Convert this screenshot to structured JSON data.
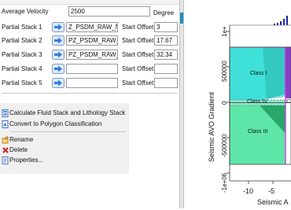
{
  "dialog": {
    "avg_velocity_label": "Average Velocity",
    "avg_velocity_value": "2500",
    "degree_header": "Degree",
    "stacks": [
      {
        "label": "Partial Stack 1",
        "dataset": "Z_PSDM_RAW_NEAR_D",
        "offset_label": "Start Offset",
        "offset_value": "3"
      },
      {
        "label": "Partial Stack 2",
        "dataset": "PZ_PSDM_RAW_MID_D",
        "offset_label": "Start Offset",
        "offset_value": "17.67"
      },
      {
        "label": "Partial Stack 3",
        "dataset": "PZ_PSDM_RAW_FAR_D",
        "offset_label": "Start Offset",
        "offset_value": "32.34"
      },
      {
        "label": "Partial Stack 4",
        "dataset": "",
        "offset_label": "Start Offset",
        "offset_value": ""
      },
      {
        "label": "Partial Stack 5",
        "dataset": "",
        "offset_label": "Start Offset",
        "offset_value": ""
      }
    ]
  },
  "context_menu": {
    "items": [
      {
        "label": "Calculate Fluid Stack and Lithology Stack",
        "icon": "calculate-icon"
      },
      {
        "label": "Convert to Polygon Classification",
        "icon": "convert-icon"
      },
      {
        "label": "Rename",
        "icon": "rename-icon"
      },
      {
        "label": "Delete",
        "icon": "delete-icon"
      },
      {
        "label": "Properties...",
        "icon": "properties-icon"
      }
    ]
  },
  "plot": {
    "y_axis_label": "Seismic AVO Gradient",
    "x_axis_label": "Seismic A",
    "y_ticks": [
      "1e+",
      "500000",
      "0",
      "-500000",
      "-1e+06"
    ],
    "x_ticks": [
      "-10",
      "-5"
    ],
    "classes": [
      "Class I",
      "Class IV",
      "C",
      "Class III"
    ],
    "colors": {
      "class_i": "#3fe0d8",
      "class_iv": "#2bbf9a",
      "class_iii": "#5ee6a8",
      "divider_magenta": "#e020e0",
      "purple_band": "#8a3cc8",
      "histogram": "#1a2aa0"
    }
  }
}
